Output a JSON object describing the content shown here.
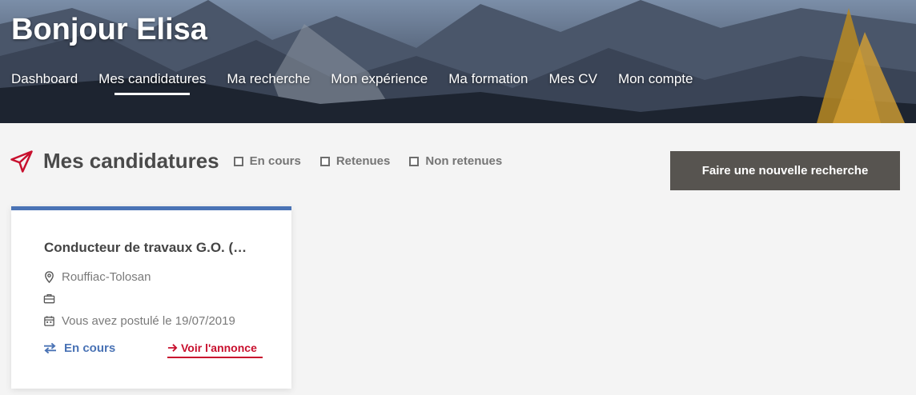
{
  "header": {
    "greeting": "Bonjour Elisa",
    "nav": [
      {
        "label": "Dashboard"
      },
      {
        "label": "Mes candidatures",
        "active": true
      },
      {
        "label": "Ma recherche"
      },
      {
        "label": "Mon expérience"
      },
      {
        "label": "Ma formation"
      },
      {
        "label": "Mes CV"
      },
      {
        "label": "Mon compte"
      }
    ]
  },
  "section": {
    "icon": "paper-plane-icon",
    "title": "Mes candidatures",
    "filters": [
      {
        "label": "En cours",
        "checked": false
      },
      {
        "label": "Retenues",
        "checked": false
      },
      {
        "label": "Non retenues",
        "checked": false
      }
    ],
    "new_search_label": "Faire une nouvelle recherche"
  },
  "card": {
    "title": "Conducteur de travaux G.O. (…",
    "location": "Rouffiac-Tolosan",
    "contract": "",
    "applied": "Vous avez postulé le 19/07/2019",
    "status": "En cours",
    "link": "Voir l'annonce"
  },
  "colors": {
    "accent_blue": "#4a73b5",
    "accent_red": "#c8102e",
    "button_dark": "#575450"
  }
}
